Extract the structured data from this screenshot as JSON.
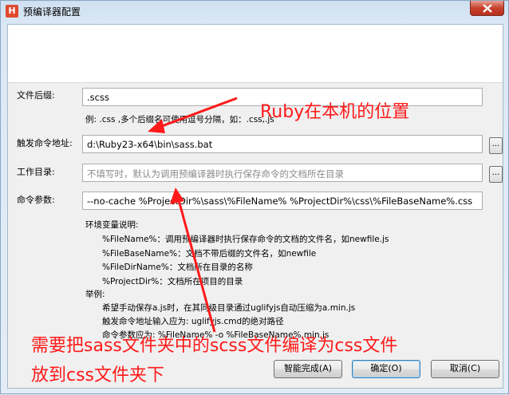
{
  "window": {
    "title": "预编译器配置",
    "icon_name": "app-h-icon",
    "icon_letter": "H"
  },
  "form": {
    "ext_label": "文件后缀:",
    "ext_value": ".scss",
    "ext_hint": "例: .css ,多个后缀名可使用逗号分隔，如：.css,.js",
    "cmd_label": "触发命令地址:",
    "cmd_value": "d:\\Ruby23-x64\\bin\\sass.bat",
    "browse_label": "...",
    "workdir_label": "工作目录:",
    "workdir_placeholder": "不填写时，默认为调用预编译器时执行保存命令的文档所在目录",
    "args_label": "命令参数:",
    "args_value": "--no-cache %ProjectDir%\\sass\\%FileName% %ProjectDir%\\css\\%FileBaseName%.css"
  },
  "help": {
    "env_title": "环境变量说明:",
    "env_lines": [
      "%FileName%：调用预编译器时执行保存命令的文档的文件名，如newfile.js",
      "%FileBaseName%：文档不带后缀的文件名，如newfile",
      "%FileDirName%：文档所在目录的名称",
      "%ProjectDir%：文档所在项目的目录"
    ],
    "example_title": "举例:",
    "example_lines": [
      "希望手动保存a.js时，在其同级目录通过uglifyjs自动压缩为a.min.js",
      "触发命令地址输入应为: uglifyjs.cmd的绝对路径",
      "命令参数应为: %FileName% -o %FileBaseName%.min.js"
    ]
  },
  "buttons": {
    "smart": "智能完成(A)",
    "ok": "确定(O)",
    "cancel": "取消(C)"
  },
  "annotations": {
    "ruby_location": "Ruby在本机的位置",
    "compile_line1": "需要把sass文件夹中的scss文件编译为css文件",
    "compile_line2": "放到css文件夹下",
    "color": "#ff1a1a"
  }
}
